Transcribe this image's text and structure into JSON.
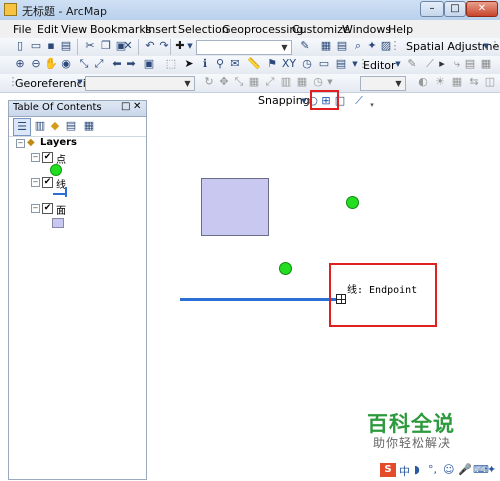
{
  "window": {
    "title": "无标题 - ArcMap",
    "min": "–",
    "max": "□",
    "close": "✕"
  },
  "menu": [
    "File",
    "Edit",
    "View",
    "Bookmarks",
    "Insert",
    "Selection",
    "Geoprocessing",
    "Customize",
    "Windows",
    "Help"
  ],
  "toolbar": {
    "spatial_adjustment": "Spatial Adjustment",
    "editor": "Editor",
    "georeferencing": "Georeferencing",
    "snapping": "Snapping"
  },
  "toc": {
    "title": "Table Of Contents",
    "root": "Layers",
    "layers": [
      {
        "name": "点",
        "checked": "✔"
      },
      {
        "name": "线",
        "checked": "✔"
      },
      {
        "name": "面",
        "checked": "✔"
      }
    ]
  },
  "map": {
    "snap_tooltip": "线: Endpoint",
    "colors": {
      "point": "#22dd22",
      "line": "#2a6fd6",
      "polygon": "#c8c8f0",
      "highlight": "#e02020"
    }
  },
  "watermark": {
    "title": "百科全说",
    "subtitle": "助你轻松解决"
  },
  "tray": {
    "lang": "中"
  }
}
